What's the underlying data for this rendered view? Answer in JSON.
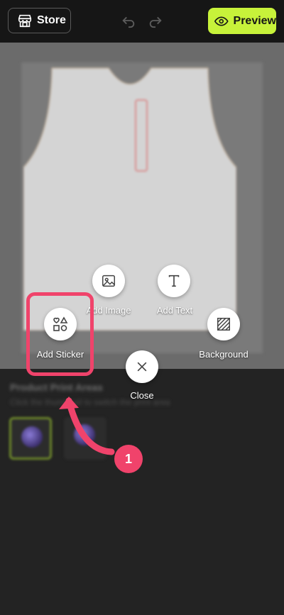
{
  "topbar": {
    "store_label": "Store",
    "preview_label": "Preview"
  },
  "bottom": {
    "title": "Product Print Areas",
    "subtitle": "Click the thumbnail to switch the print area"
  },
  "menu": {
    "add_image": "Add Image",
    "add_text": "Add Text",
    "add_sticker": "Add Sticker",
    "background": "Background",
    "close": "Close"
  },
  "tutorial": {
    "step_number": "1"
  },
  "colors": {
    "accent": "#c7f23a",
    "highlight": "#f0436b"
  }
}
